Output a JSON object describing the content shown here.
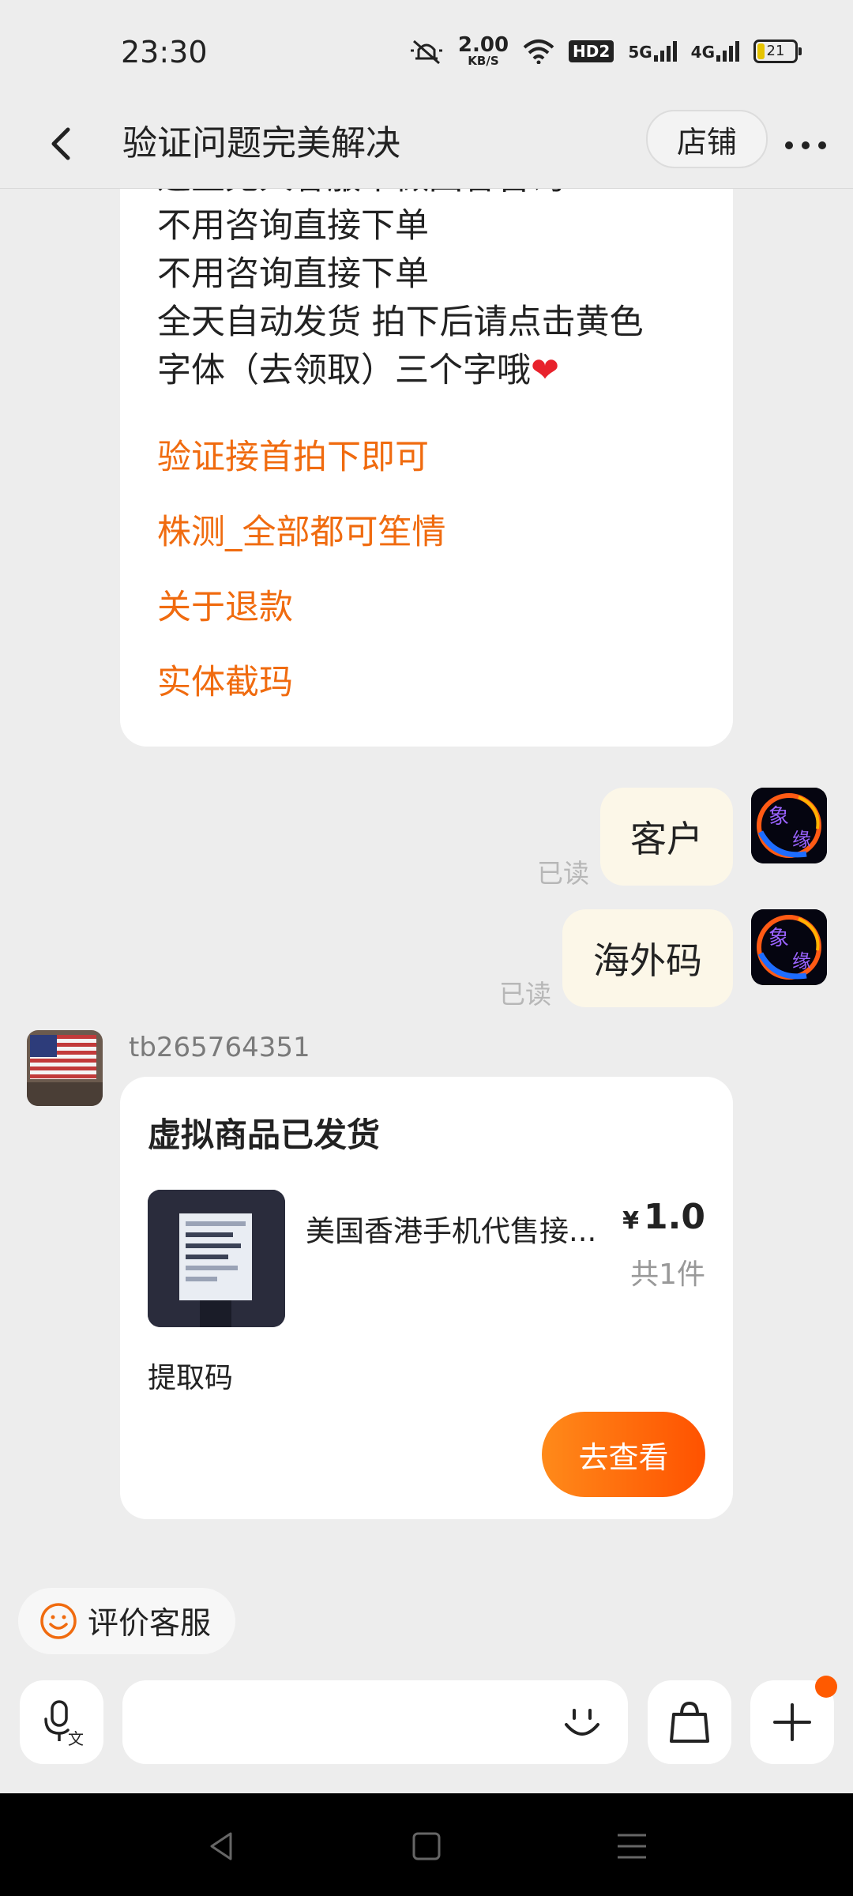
{
  "status_bar": {
    "time": "23:30",
    "speed_value": "2.00",
    "speed_unit": "KB/S",
    "hd": "HD2",
    "net1": "5G",
    "net2": "4G",
    "battery": "21"
  },
  "header": {
    "title": "验证问题完美解决",
    "shop_button": "店铺"
  },
  "auto_reply": {
    "lines": [
      "这里无人客服不做回答咨询",
      "不用咨询直接下单",
      "不用咨询直接下单",
      "全天自动发货 拍下后请点击黄色",
      "字体（去领取）三个字哦"
    ],
    "heart": "❤",
    "links": [
      "验证接首拍下即可",
      "株测_全部都可笙情",
      "关于退款",
      "实体截玛"
    ]
  },
  "user_messages": [
    {
      "text": "客户",
      "status": "已读"
    },
    {
      "text": "海外码",
      "status": "已读"
    }
  ],
  "seller": {
    "name": "tb265764351"
  },
  "order_card": {
    "title": "虚拟商品已发货",
    "product_name": "美国香港手机代售接...",
    "price_symbol": "¥",
    "price": "1.0",
    "quantity": "共1件",
    "code_label": "提取码",
    "view_button": "去查看"
  },
  "rate_service": "评价客服",
  "icons": [
    "back-icon",
    "more-icon",
    "smile-icon",
    "voice-icon",
    "emoji-icon",
    "bag-icon",
    "plus-icon"
  ],
  "colors": {
    "accent": "#f06b0f",
    "button_start": "#ff8a1a",
    "button_end": "#ff5200",
    "bubble": "#fcf7e8"
  }
}
